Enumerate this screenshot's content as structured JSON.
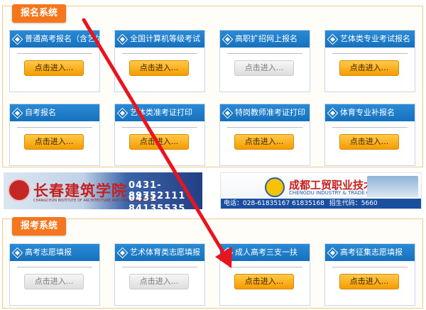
{
  "baoming": {
    "title": "报名系统",
    "cards": [
      {
        "label": "普通高考报名（含艺体）",
        "button": "点击进入...",
        "state": "active"
      },
      {
        "label": "全国计算机等级考试",
        "button": "点击进入...",
        "state": "active"
      },
      {
        "label": "高职扩招网上报名",
        "button": "点击进入...",
        "state": "disabled"
      },
      {
        "label": "艺体类专业考试报名",
        "button": "点击进入...",
        "state": "active"
      },
      {
        "label": "自考报名",
        "button": "点击进入...",
        "state": "active"
      },
      {
        "label": "艺体类准考证打印",
        "button": "点击进入...",
        "state": "active"
      },
      {
        "label": "特岗教师准考证打印",
        "button": "点击进入...",
        "state": "active"
      },
      {
        "label": "体育专业补报名",
        "button": "点击进入...",
        "state": "active"
      }
    ]
  },
  "banners": {
    "left": {
      "title": "长春建筑学院",
      "subtitle": "CHANGCHUN INSTITUTE OF ARCHITECTURE AND CIVIL ENGINEERING",
      "phones": [
        "0431-89752111",
        "0431-84135535"
      ]
    },
    "right": {
      "title": "成都工贸职业技术学院",
      "subtitle": "CHENGDU INDUSTRY & TRADE COLLEGE",
      "phone": "电话：028-61835167 61835168",
      "code": "招生代码：5660"
    }
  },
  "baokao": {
    "title": "报考系统",
    "cards": [
      {
        "label": "高考志愿填报",
        "button": "点击进入...",
        "state": "disabled"
      },
      {
        "label": "艺术体育类志愿填报",
        "button": "点击进入...",
        "state": "disabled"
      },
      {
        "label": "成人高考三支一扶",
        "button": "点击进入...",
        "state": "active"
      },
      {
        "label": "高考征集志愿填报",
        "button": "点击进入...",
        "state": "active"
      }
    ]
  },
  "colors": {
    "accent": "#f5761d",
    "header_blue": "#1672bd",
    "button_orange": "#f59c00",
    "annotation_red": "#e8141e"
  }
}
